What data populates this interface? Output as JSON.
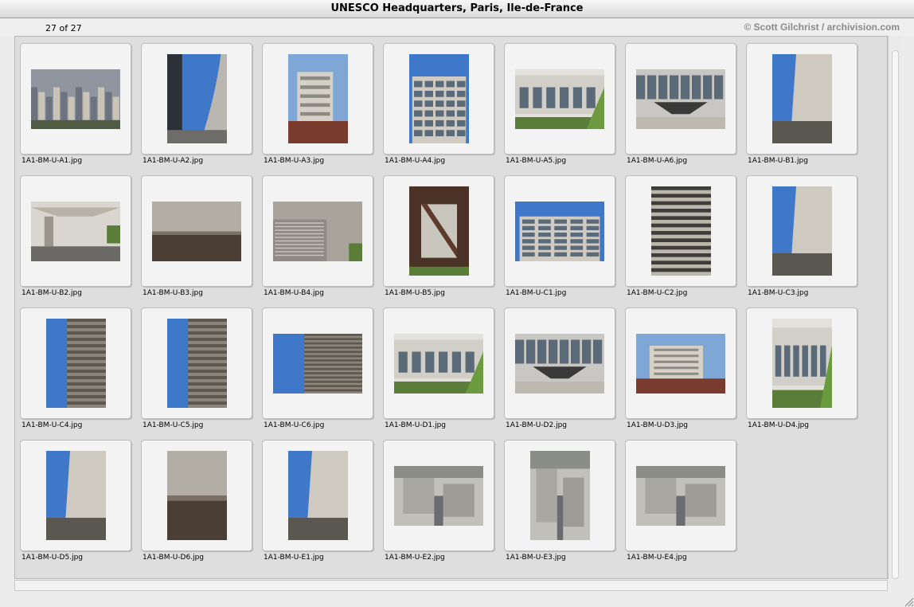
{
  "window": {
    "title": "UNESCO Headquarters, Paris, Ile-de-France"
  },
  "toolbar": {
    "count": "27 of 27",
    "credit": "© Scott Gilchrist / archivision.com"
  },
  "colors": {
    "sky": "#3f77c9",
    "concrete": "#a9a49a",
    "dark": "#3c3a36",
    "window": "#5b6a78",
    "green": "#5b7d3a"
  },
  "thumbnails": [
    {
      "file": "1A1-BM-U-A1.jpg",
      "orientation": "landscape",
      "scene": "city"
    },
    {
      "file": "1A1-BM-U-A2.jpg",
      "orientation": "portrait",
      "scene": "curve-sky"
    },
    {
      "file": "1A1-BM-U-A3.jpg",
      "orientation": "portrait",
      "scene": "facade-sky"
    },
    {
      "file": "1A1-BM-U-A4.jpg",
      "orientation": "portrait",
      "scene": "windows-sky"
    },
    {
      "file": "1A1-BM-U-A5.jpg",
      "orientation": "landscape",
      "scene": "facade-trees"
    },
    {
      "file": "1A1-BM-U-A6.jpg",
      "orientation": "landscape",
      "scene": "entrance"
    },
    {
      "file": "1A1-BM-U-B1.jpg",
      "orientation": "portrait",
      "scene": "wall-sky"
    },
    {
      "file": "1A1-BM-U-B2.jpg",
      "orientation": "landscape",
      "scene": "canopy"
    },
    {
      "file": "1A1-BM-U-B3.jpg",
      "orientation": "landscape",
      "scene": "concrete"
    },
    {
      "file": "1A1-BM-U-B4.jpg",
      "orientation": "landscape",
      "scene": "concrete-wall"
    },
    {
      "file": "1A1-BM-U-B5.jpg",
      "orientation": "portrait",
      "scene": "interior"
    },
    {
      "file": "1A1-BM-U-C1.jpg",
      "orientation": "landscape",
      "scene": "windows-sky"
    },
    {
      "file": "1A1-BM-U-C2.jpg",
      "orientation": "portrait",
      "scene": "louvers"
    },
    {
      "file": "1A1-BM-U-C3.jpg",
      "orientation": "portrait",
      "scene": "wall-sky"
    },
    {
      "file": "1A1-BM-U-C4.jpg",
      "orientation": "portrait",
      "scene": "louvers-sky"
    },
    {
      "file": "1A1-BM-U-C5.jpg",
      "orientation": "portrait",
      "scene": "louvers-sky"
    },
    {
      "file": "1A1-BM-U-C6.jpg",
      "orientation": "landscape",
      "scene": "louvers-sky"
    },
    {
      "file": "1A1-BM-U-D1.jpg",
      "orientation": "landscape",
      "scene": "facade-trees"
    },
    {
      "file": "1A1-BM-U-D2.jpg",
      "orientation": "landscape",
      "scene": "entrance"
    },
    {
      "file": "1A1-BM-U-D3.jpg",
      "orientation": "landscape",
      "scene": "facade-sky"
    },
    {
      "file": "1A1-BM-U-D4.jpg",
      "orientation": "portrait",
      "scene": "facade-trees"
    },
    {
      "file": "1A1-BM-U-D5.jpg",
      "orientation": "portrait",
      "scene": "wall-sky"
    },
    {
      "file": "1A1-BM-U-D6.jpg",
      "orientation": "portrait",
      "scene": "concrete"
    },
    {
      "file": "1A1-BM-U-E1.jpg",
      "orientation": "portrait",
      "scene": "wall-sky"
    },
    {
      "file": "1A1-BM-U-E2.jpg",
      "orientation": "landscape",
      "scene": "courtyard"
    },
    {
      "file": "1A1-BM-U-E3.jpg",
      "orientation": "portrait",
      "scene": "courtyard"
    },
    {
      "file": "1A1-BM-U-E4.jpg",
      "orientation": "landscape",
      "scene": "courtyard"
    }
  ]
}
